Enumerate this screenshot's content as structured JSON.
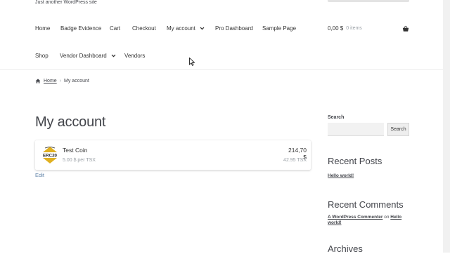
{
  "site": {
    "tagline": "Just another WordPress site"
  },
  "nav": {
    "row1": [
      {
        "label": "Home"
      },
      {
        "label": "Badge Evidence"
      },
      {
        "label": "Cart"
      },
      {
        "label": "Checkout"
      },
      {
        "label": "My account"
      },
      {
        "label": "Pro Dashboard"
      },
      {
        "label": "Sample Page"
      }
    ],
    "row2": [
      {
        "label": "Shop"
      },
      {
        "label": "Vendor Dashboard"
      },
      {
        "label": "Vendors"
      }
    ]
  },
  "cart": {
    "total": "0,00 $",
    "items": "0 items"
  },
  "breadcrumb": {
    "home": "Home",
    "separator": "›",
    "current": "My account"
  },
  "page": {
    "title": "My account"
  },
  "token": {
    "logo_text": "ERC20",
    "name": "Test Coin",
    "price": "5.00 $ per TSX",
    "value": "214,70 $",
    "amount": "42.95 TSX",
    "edit": "Edit"
  },
  "sidebar": {
    "search_label": "Search",
    "search_value": "",
    "search_button": "Search",
    "recent_posts_title": "Recent Posts",
    "recent_post": "Hello world!",
    "recent_comments_title": "Recent Comments",
    "comment_author": "A WordPress Commenter",
    "comment_on": "on",
    "comment_post": "Hello world!",
    "archives_title": "Archives"
  },
  "colors": {
    "link": "#5b7fa6",
    "text": "#43454b",
    "muted": "#9aa0a6"
  }
}
